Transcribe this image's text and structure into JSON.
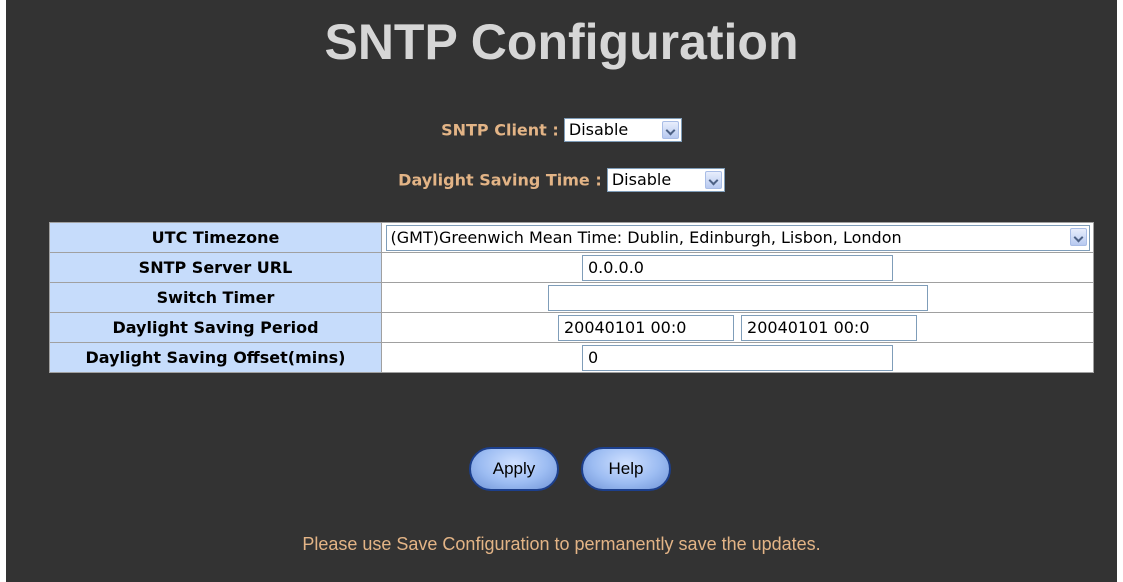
{
  "title": "SNTP Configuration",
  "sntp_client": {
    "label": "SNTP Client :",
    "value": "Disable"
  },
  "dst": {
    "label": "Daylight Saving Time :",
    "value": "Disable"
  },
  "table": {
    "utc_timezone": {
      "label": "UTC Timezone",
      "value": "(GMT)Greenwich Mean Time: Dublin, Edinburgh, Lisbon, London"
    },
    "server_url": {
      "label": "SNTP Server URL",
      "value": "0.0.0.0"
    },
    "switch_timer": {
      "label": "Switch Timer",
      "value": ""
    },
    "dst_period": {
      "label": "Daylight Saving Period",
      "start": "20040101 00:0",
      "end": "20040101 00:0"
    },
    "dst_offset": {
      "label": "Daylight Saving Offset(mins)",
      "value": "0"
    }
  },
  "buttons": {
    "apply": "Apply",
    "help": "Help"
  },
  "note": "Please use Save Configuration to permanently save the updates.",
  "colors": {
    "background": "#333333",
    "label_orange": "#e3b486",
    "header_cell_blue": "#c6dcfb",
    "title_gray": "#d6d6d6"
  }
}
